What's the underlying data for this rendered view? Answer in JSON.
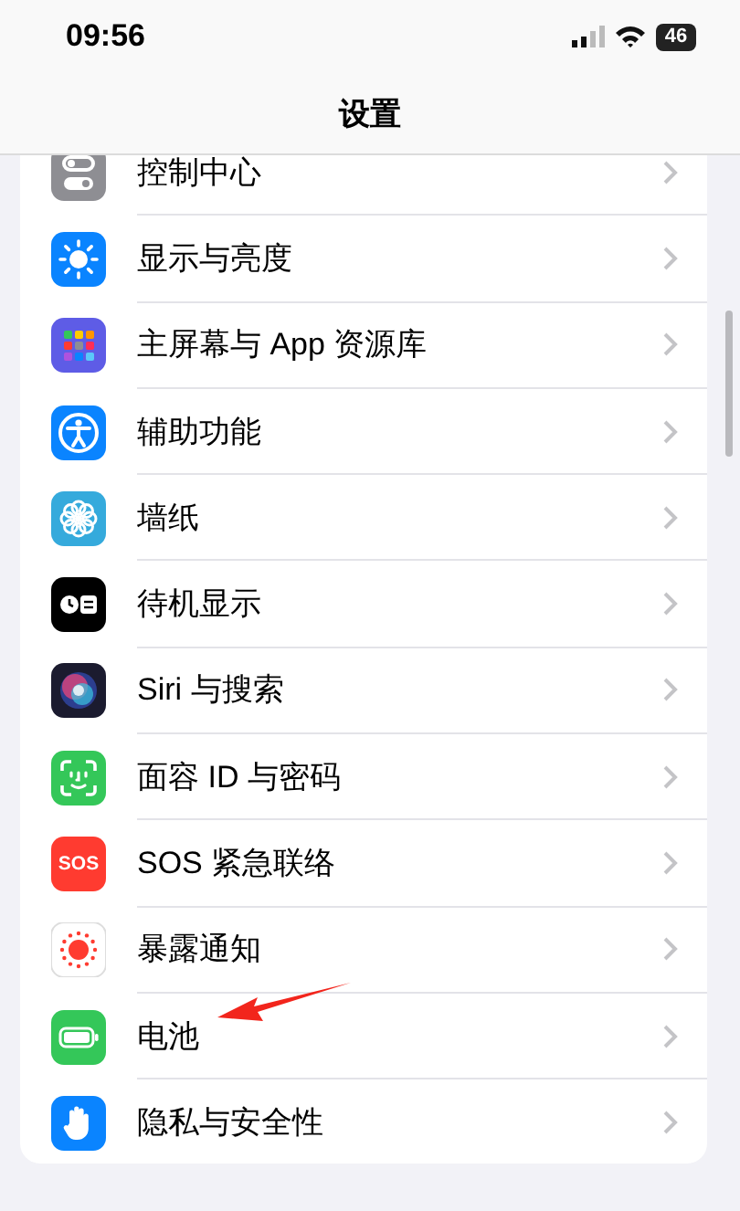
{
  "status_bar": {
    "time": "09:56",
    "battery": "46"
  },
  "nav": {
    "title": "设置"
  },
  "rows": [
    {
      "label": "控制中心"
    },
    {
      "label": "显示与亮度"
    },
    {
      "label": "主屏幕与 App 资源库"
    },
    {
      "label": "辅助功能"
    },
    {
      "label": "墙纸"
    },
    {
      "label": "待机显示"
    },
    {
      "label": "Siri 与搜索"
    },
    {
      "label": "面容 ID 与密码"
    },
    {
      "label": "SOS 紧急联络",
      "icon_text": "SOS"
    },
    {
      "label": "暴露通知"
    },
    {
      "label": "电池"
    },
    {
      "label": "隐私与安全性"
    }
  ]
}
